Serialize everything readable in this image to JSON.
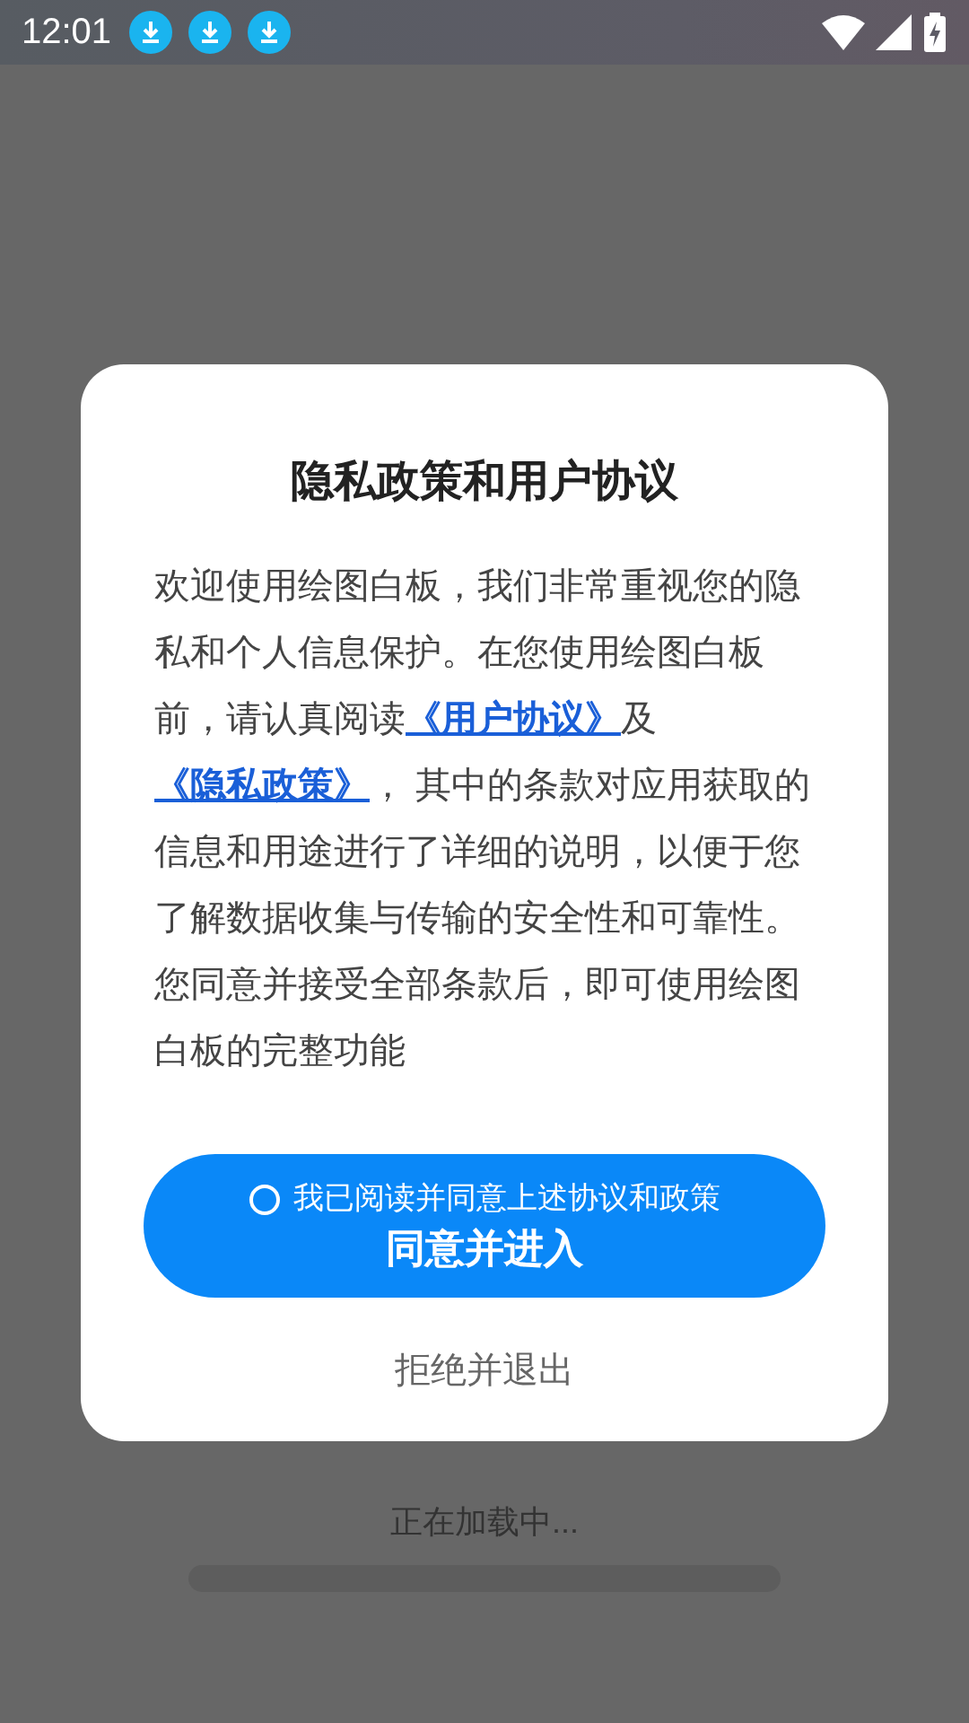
{
  "status_bar": {
    "time": "12:01",
    "notifications": [
      {
        "kind": "download"
      },
      {
        "kind": "download"
      },
      {
        "kind": "download"
      }
    ]
  },
  "dialog": {
    "title": "隐私政策和用户协议",
    "body": [
      {
        "kind": "text",
        "text": "欢迎使用绘图白板，我们非常重视您的隐私和个人信息保护。在您使用绘图白板前，请认真阅读"
      },
      {
        "kind": "link",
        "text": "《用户协议》"
      },
      {
        "kind": "text",
        "text": "及"
      },
      {
        "kind": "link",
        "text": "《隐私政策》"
      },
      {
        "kind": "text",
        "text": "， 其中的条款对应用获取的信息和用途进行了详细的说明，以便于您了解数据收集与传输的安全性和可靠性。您同意并接受全部条款后，即可使用绘图白板的完整功能"
      }
    ],
    "consent": {
      "label": "我已阅读并同意上述协议和政策",
      "checked": false
    },
    "agree_button": "同意并进入",
    "decline_button": "拒绝并退出"
  },
  "loading": {
    "text": "正在加载中...",
    "level": 0
  }
}
